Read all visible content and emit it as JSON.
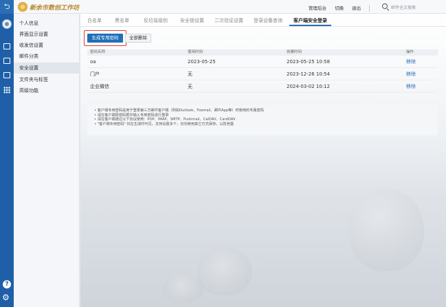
{
  "header": {
    "logo_text": "新余市数创工作坊",
    "links": [
      "管理后台",
      "切换",
      "退出"
    ],
    "search_placeholder": "邮件全文搜索"
  },
  "nav": {
    "items": [
      {
        "label": "个人信息",
        "active": false
      },
      {
        "label": "界面显示设置",
        "active": false
      },
      {
        "label": "收发信设置",
        "active": false
      },
      {
        "label": "邮件分类",
        "active": false
      },
      {
        "label": "安全设置",
        "active": true
      },
      {
        "label": "文件夹与标签",
        "active": false
      },
      {
        "label": "高级功能",
        "active": false
      }
    ]
  },
  "tabs": [
    {
      "label": "白名单",
      "active": false
    },
    {
      "label": "黑名单",
      "active": false
    },
    {
      "label": "反垃圾级别",
      "active": false
    },
    {
      "label": "安全锁设置",
      "active": false
    },
    {
      "label": "二次验证设置",
      "active": false
    },
    {
      "label": "登录设备查询",
      "active": false
    },
    {
      "label": "客户端安全登录",
      "active": true
    }
  ],
  "toolbar": {
    "generate_label": "生成专用密码",
    "delete_all_label": "全部删除"
  },
  "table": {
    "headers": [
      "密码名称",
      "使用时间",
      "创建时间",
      "操作"
    ],
    "rows": [
      {
        "name": "oa",
        "used": "2023-05-25",
        "created": "2023-05-25 10:58",
        "action": "移除"
      },
      {
        "name": "门户",
        "used": "无",
        "created": "2023-12-26 10:54",
        "action": "移除"
      },
      {
        "name": "企业微信",
        "used": "无",
        "created": "2024-03-02 10:12",
        "action": "移除"
      }
    ]
  },
  "notes": [
    "客户端专用密码是用于登录第三方邮件客户端（例如Outlook、Foxmail、邮件App等）时使用的专属密码",
    "请在客户端原密码框中输入专用密码进行登录",
    "请在客户端通过以下协议使用：POP、IMAP、SMTP、Pushmail、CalDAV、CardDAV",
    "\"客户端专用密码\" 仅在生成时可见，支持设置多个，切勿使用其它方式保存，以防泄露"
  ],
  "colors": {
    "rail": "#1f5fa8",
    "primary": "#1f6fb8",
    "link": "#2a6eb5",
    "highlight": "#e23b2e"
  }
}
